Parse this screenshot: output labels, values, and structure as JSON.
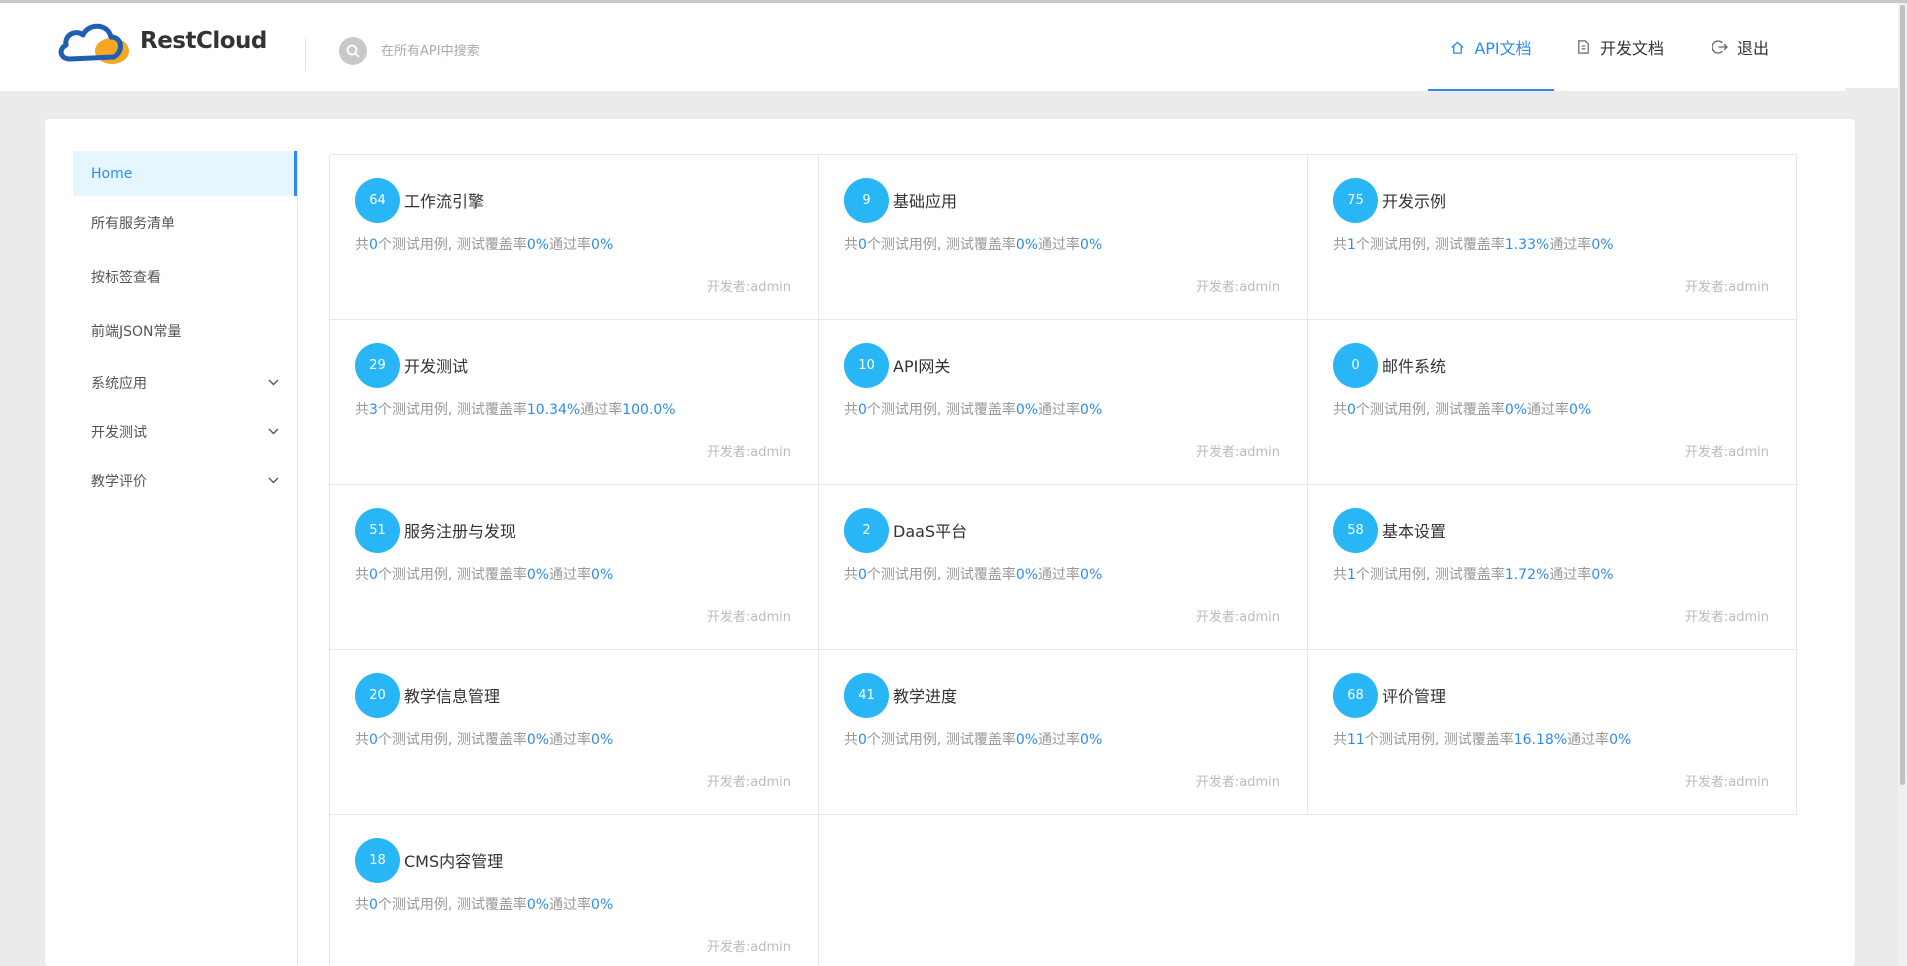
{
  "app": {
    "logo_text": "RestCloud",
    "colors": {
      "accent": "#2d8cf0",
      "badge": "#28b6f6",
      "logo_blue": "#1e5fb4",
      "logo_orange": "#f5a623"
    }
  },
  "search": {
    "placeholder": "在所有API中搜索",
    "icon": "search-icon"
  },
  "nav": [
    {
      "label": "API文档",
      "icon": "home-icon",
      "active": true
    },
    {
      "label": "开发文档",
      "icon": "document-icon",
      "active": false
    },
    {
      "label": "退出",
      "icon": "logout-icon",
      "active": false
    }
  ],
  "sidebar": {
    "items": [
      {
        "label": "Home",
        "active": true,
        "expandable": false
      },
      {
        "label": "所有服务清单",
        "expandable": false
      },
      {
        "label": "按标签查看",
        "expandable": false
      },
      {
        "label": "前端JSON常量",
        "expandable": false
      },
      {
        "label": "系统应用",
        "expandable": true
      },
      {
        "label": "开发测试",
        "expandable": true
      },
      {
        "label": "教学评价",
        "expandable": true
      }
    ]
  },
  "cards": [
    {
      "count": "64",
      "title": "工作流引擎",
      "p1": "共",
      "cases": "0",
      "p2": "个测试用例, 测试覆盖率",
      "coverage": "0%",
      "p3": "通过率",
      "pass": "0%",
      "developer": "开发者:admin"
    },
    {
      "count": "9",
      "title": "基础应用",
      "p1": "共",
      "cases": "0",
      "p2": "个测试用例, 测试覆盖率",
      "coverage": "0%",
      "p3": "通过率",
      "pass": "0%",
      "developer": "开发者:admin"
    },
    {
      "count": "75",
      "title": "开发示例",
      "p1": "共",
      "cases": "1",
      "p2": "个测试用例, 测试覆盖率",
      "coverage": "1.33%",
      "p3": "通过率",
      "pass": "0%",
      "developer": "开发者:admin"
    },
    {
      "count": "29",
      "title": "开发测试",
      "p1": "共",
      "cases": "3",
      "p2": "个测试用例, 测试覆盖率",
      "coverage": "10.34%",
      "p3": "通过率",
      "pass": "100.0%",
      "developer": "开发者:admin"
    },
    {
      "count": "10",
      "title": "API网关",
      "p1": "共",
      "cases": "0",
      "p2": "个测试用例, 测试覆盖率",
      "coverage": "0%",
      "p3": "通过率",
      "pass": "0%",
      "developer": "开发者:admin"
    },
    {
      "count": "0",
      "title": "邮件系统",
      "p1": "共",
      "cases": "0",
      "p2": "个测试用例, 测试覆盖率",
      "coverage": "0%",
      "p3": "通过率",
      "pass": "0%",
      "developer": "开发者:admin"
    },
    {
      "count": "51",
      "title": "服务注册与发现",
      "p1": "共",
      "cases": "0",
      "p2": "个测试用例, 测试覆盖率",
      "coverage": "0%",
      "p3": "通过率",
      "pass": "0%",
      "developer": "开发者:admin"
    },
    {
      "count": "2",
      "title": "DaaS平台",
      "p1": "共",
      "cases": "0",
      "p2": "个测试用例, 测试覆盖率",
      "coverage": "0%",
      "p3": "通过率",
      "pass": "0%",
      "developer": "开发者:admin"
    },
    {
      "count": "58",
      "title": "基本设置",
      "p1": "共",
      "cases": "1",
      "p2": "个测试用例, 测试覆盖率",
      "coverage": "1.72%",
      "p3": "通过率",
      "pass": "0%",
      "developer": "开发者:admin"
    },
    {
      "count": "20",
      "title": "教学信息管理",
      "p1": "共",
      "cases": "0",
      "p2": "个测试用例, 测试覆盖率",
      "coverage": "0%",
      "p3": "通过率",
      "pass": "0%",
      "developer": "开发者:admin"
    },
    {
      "count": "41",
      "title": "教学进度",
      "p1": "共",
      "cases": "0",
      "p2": "个测试用例, 测试覆盖率",
      "coverage": "0%",
      "p3": "通过率",
      "pass": "0%",
      "developer": "开发者:admin"
    },
    {
      "count": "68",
      "title": "评价管理",
      "p1": "共",
      "cases": "11",
      "p2": "个测试用例, 测试覆盖率",
      "coverage": "16.18%",
      "p3": "通过率",
      "pass": "0%",
      "developer": "开发者:admin"
    },
    {
      "count": "18",
      "title": "CMS内容管理",
      "p1": "共",
      "cases": "0",
      "p2": "个测试用例, 测试覆盖率",
      "coverage": "0%",
      "p3": "通过率",
      "pass": "0%",
      "developer": "开发者:admin"
    }
  ]
}
